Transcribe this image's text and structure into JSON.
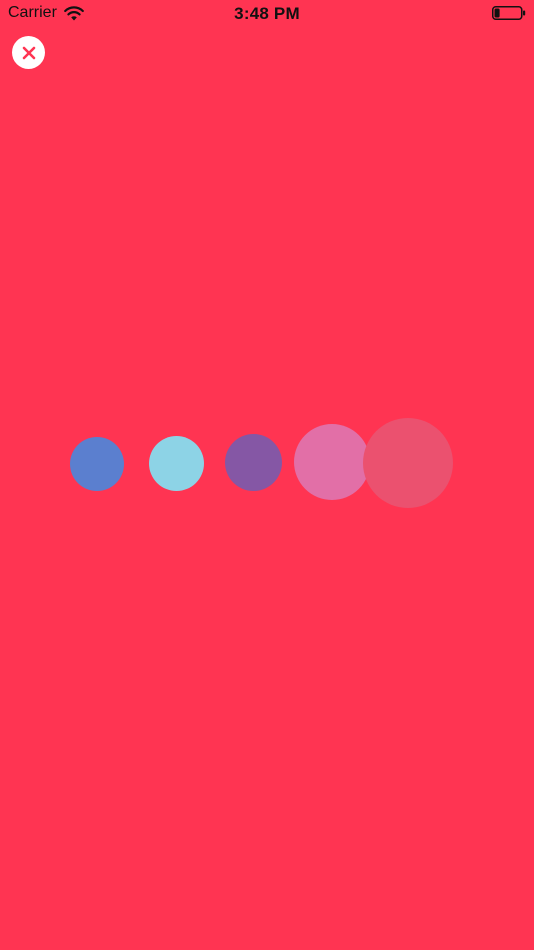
{
  "status_bar": {
    "carrier": "Carrier",
    "time": "3:48 PM",
    "battery_level": 0.2,
    "icons": [
      "wifi-icon",
      "battery-icon"
    ]
  },
  "close_button": {
    "icon": "close-icon",
    "icon_color": "#ff3452",
    "background": "#ffffff"
  },
  "background_color": "#ff3452",
  "loader_dots": [
    {
      "color": "#5b7fcf",
      "opacity": 1
    },
    {
      "color": "#8dd3e6",
      "opacity": 1
    },
    {
      "color": "#8557a5",
      "opacity": 1
    },
    {
      "color": "#e26fa7",
      "opacity": 1
    },
    {
      "color": "#eb516f",
      "opacity": 1
    }
  ]
}
